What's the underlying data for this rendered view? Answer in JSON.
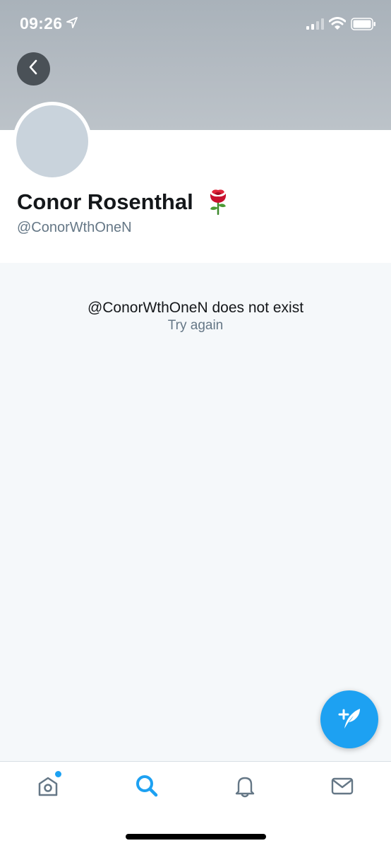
{
  "status_bar": {
    "time": "09:26"
  },
  "profile": {
    "display_name": "Conor Rosenthal",
    "handle": "@ConorWthOneN",
    "name_emoji": "rose-icon"
  },
  "error": {
    "message": "@ConorWthOneN does not exist",
    "retry_label": "Try again"
  },
  "tabs": [
    {
      "name": "home",
      "icon": "home-icon",
      "active": false,
      "has_badge": true
    },
    {
      "name": "search",
      "icon": "search-icon",
      "active": true
    },
    {
      "name": "notifications",
      "icon": "bell-icon",
      "active": false
    },
    {
      "name": "messages",
      "icon": "mail-icon",
      "active": false
    }
  ],
  "colors": {
    "accent": "#1da1f2",
    "secondary_text": "#657786",
    "primary_text": "#14171a",
    "banner": "#b5bcc3"
  }
}
